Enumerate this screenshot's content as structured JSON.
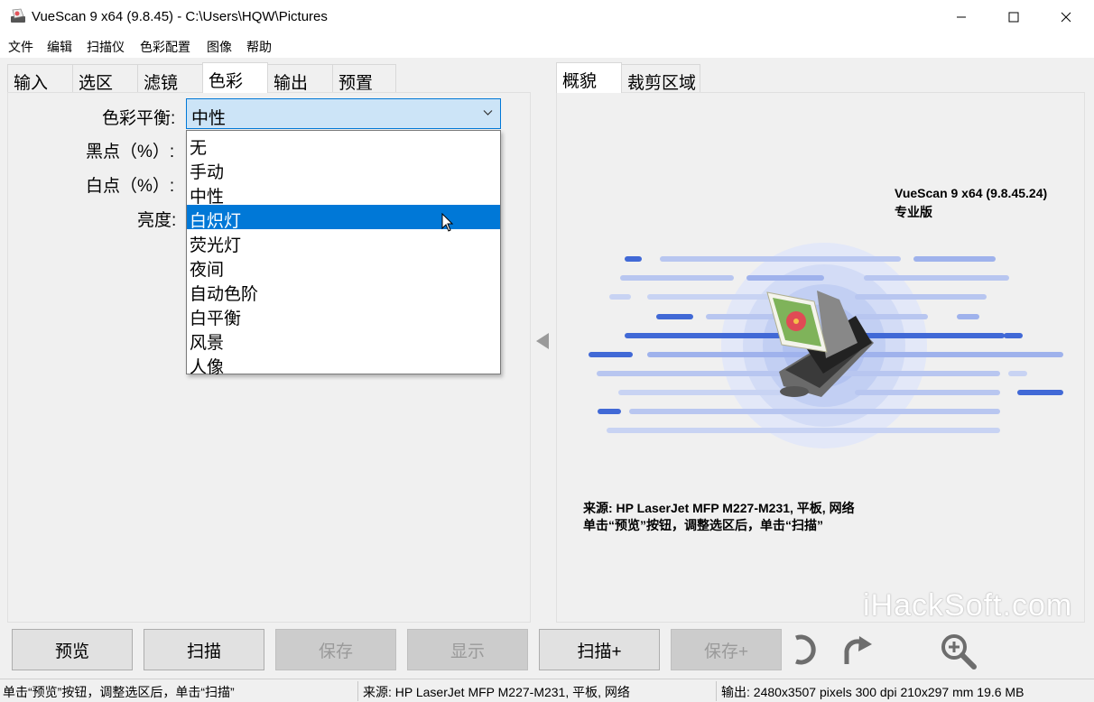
{
  "window": {
    "title": "VueScan 9 x64 (9.8.45) - C:\\Users\\HQW\\Pictures",
    "app_icon": "scanner-app-icon",
    "controls": [
      "minimize-icon",
      "maximize-icon",
      "close-icon"
    ]
  },
  "menu": [
    "文件",
    "编辑",
    "扫描仪",
    "色彩配置",
    "图像",
    "帮助"
  ],
  "left_tabs": [
    {
      "label": "输入",
      "active": false
    },
    {
      "label": "选区",
      "active": false
    },
    {
      "label": "滤镜",
      "active": false
    },
    {
      "label": "色彩",
      "active": true
    },
    {
      "label": "输出",
      "active": false
    },
    {
      "label": "预置",
      "active": false
    }
  ],
  "right_tabs": [
    {
      "label": "概貌",
      "active": true
    },
    {
      "label": "裁剪区域",
      "active": false
    }
  ],
  "color_tab": {
    "fields": [
      {
        "label": "色彩平衡:"
      },
      {
        "label": "黑点（%）:"
      },
      {
        "label": "白点（%）:"
      },
      {
        "label": "亮度:"
      }
    ],
    "color_balance": {
      "value": "中性",
      "options": [
        "无",
        "手动",
        "中性",
        "白炽灯",
        "荧光灯",
        "夜间",
        "自动色阶",
        "白平衡",
        "风景",
        "人像"
      ],
      "highlighted": "白炽灯"
    }
  },
  "overview": {
    "version": "VueScan 9 x64 (9.8.45.24)",
    "edition": "专业版",
    "source": "来源: HP LaserJet MFP M227-M231, 平板, 网络",
    "hint": "单击“预览”按钮，调整选区后，单击“扫描”",
    "watermark": "iHackSoft.com",
    "colors": {
      "wave_dark": "#4169d6",
      "wave_light": "#b8c6f0",
      "glow": "#c9d4f7"
    }
  },
  "buttons": [
    {
      "label": "预览",
      "enabled": true
    },
    {
      "label": "扫描",
      "enabled": true
    },
    {
      "label": "保存",
      "enabled": false
    },
    {
      "label": "显示",
      "enabled": false
    },
    {
      "label": "扫描+",
      "enabled": true
    },
    {
      "label": "保存+",
      "enabled": false
    }
  ],
  "tool_icons": [
    "rotate-left-icon",
    "rotate-right-icon",
    "zoom-in-icon"
  ],
  "status": {
    "left": "单击“预览”按钮，调整选区后，单击“扫描”",
    "middle": "来源: HP LaserJet MFP M227-M231, 平板, 网络",
    "right": "输出: 2480x3507 pixels 300 dpi 210x297 mm 19.6 MB"
  },
  "accent_color": "#0078d7"
}
